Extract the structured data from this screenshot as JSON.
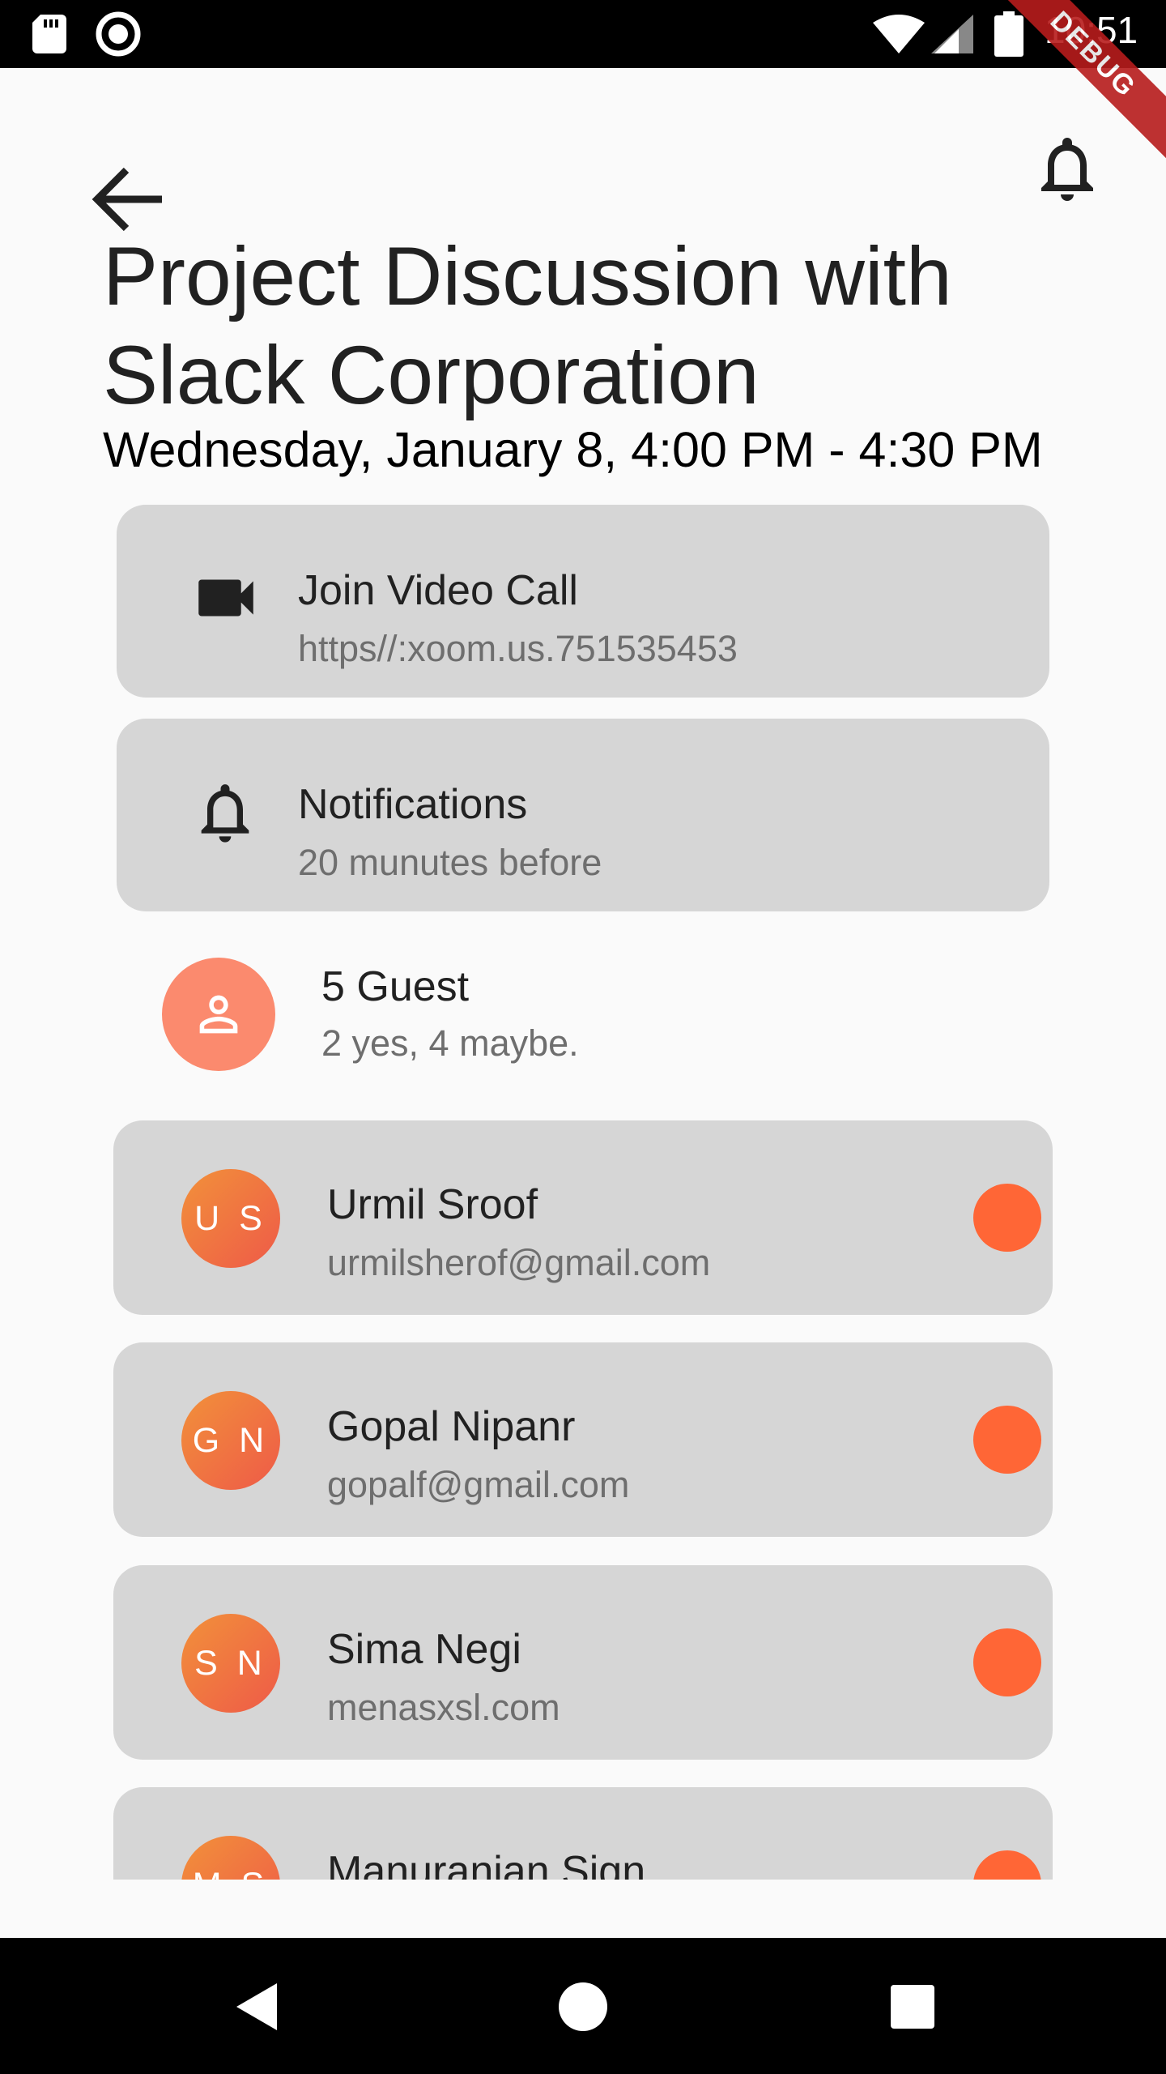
{
  "status_bar": {
    "time": "10:51",
    "icons": [
      "sd-card-icon",
      "record-icon",
      "wifi-icon",
      "signal-icon",
      "battery-icon"
    ]
  },
  "debug_banner": "DEBUG",
  "header": {
    "back_icon": "arrow-back-icon",
    "action_icon": "bell-icon"
  },
  "event": {
    "title": "Project Discussion with Slack Corporation",
    "date_range": "Wednesday, January 8, 4:00 PM - 4:30 PM"
  },
  "video_call": {
    "icon": "videocam-icon",
    "title": "Join Video Call",
    "link": "https//:xoom.us.751535453"
  },
  "notifications": {
    "icon": "bell-icon",
    "title": "Notifications",
    "detail": "20 munutes before"
  },
  "guests": {
    "icon": "person-icon",
    "title": "5 Guest",
    "summary": "2 yes, 4 maybe.",
    "list": [
      {
        "initials": "U S",
        "name": "Urmil Sroof",
        "email": "urmilsherof@gmail.com"
      },
      {
        "initials": "G N",
        "name": "Gopal Nipanr",
        "email": "gopalf@gmail.com"
      },
      {
        "initials": "S N",
        "name": "Sima Negi",
        "email": "menasxsl.com"
      },
      {
        "initials": "M S",
        "name": "Manuranjan Sign",
        "email": ""
      }
    ]
  },
  "colors": {
    "card_bg": "#d6d6d6",
    "accent_dot": "#ff6636",
    "guest_avatar": "#fb8a6e",
    "avatar_gradient_start": "#f2913a",
    "avatar_gradient_end": "#ee5a48"
  },
  "nav_bar": {
    "icons": [
      "nav-back-icon",
      "nav-home-icon",
      "nav-recents-icon"
    ]
  }
}
